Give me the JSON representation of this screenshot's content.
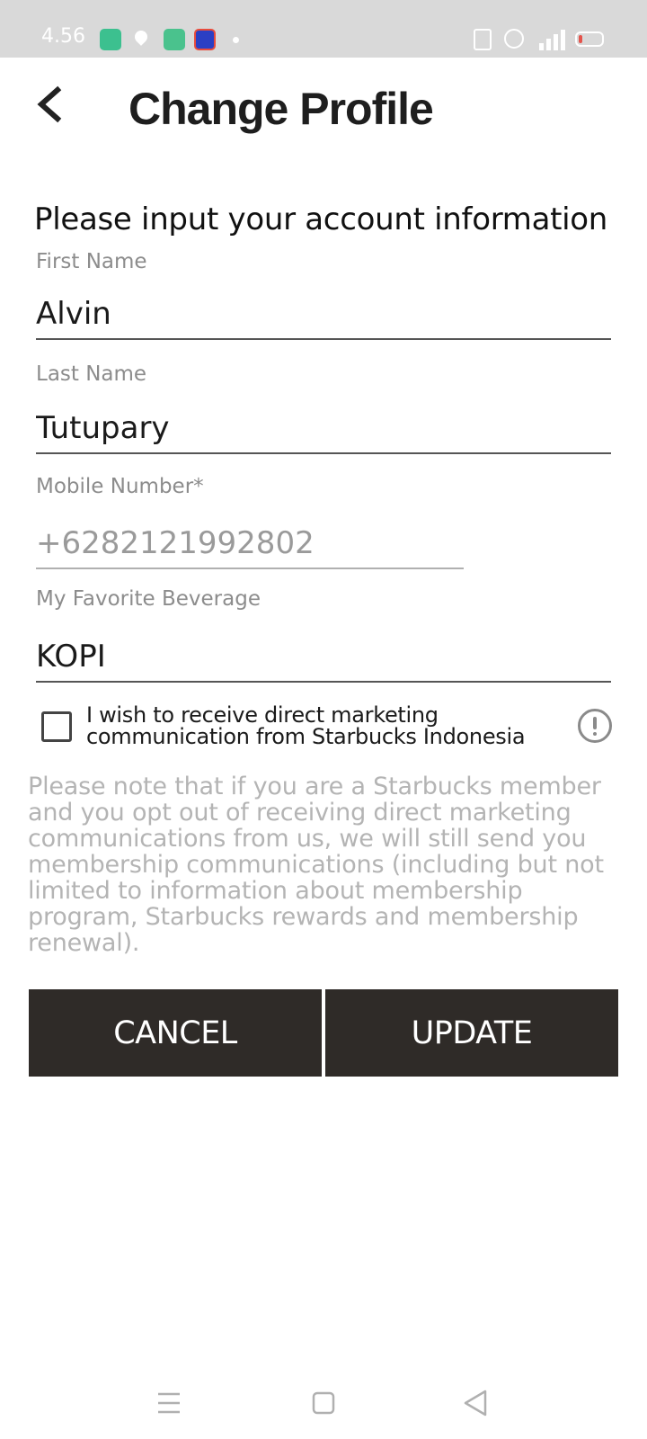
{
  "status_bar": {
    "time": "4.56",
    "icons": [
      "app-icon",
      "location-icon",
      "app-icon",
      "app-icon",
      "notification-dot",
      "vibrate-icon",
      "alarm-icon",
      "signal-4g-icon",
      "battery-icon"
    ]
  },
  "header": {
    "back_icon": "chevron-left-icon",
    "title": "Change Profile"
  },
  "form": {
    "heading": "Please input your account information",
    "first_name": {
      "label": "First Name",
      "value": "Alvin"
    },
    "last_name": {
      "label": "Last Name",
      "value": "Tutupary"
    },
    "mobile": {
      "label": "Mobile Number*",
      "value": "+628212199280​2"
    },
    "beverage": {
      "label": "My Favorite Beverage",
      "value": "KOPI"
    }
  },
  "marketing": {
    "checked": false,
    "label": "I wish to receive direct marketing communication from Starbucks Indonesia",
    "info_icon": "info-icon",
    "disclaimer": "Please note that if you are a Starbucks member and you opt out of receiving direct marketing communications from us, we will still send you membership communications (including but not limited to information about membership program, Starbucks rewards and membership renewal)."
  },
  "actions": {
    "cancel_label": "CANCEL",
    "update_label": "UPDATE"
  },
  "colors": {
    "button_bg": "#2f2b28",
    "status_bar_bg": "#d9d9d9",
    "label_gray": "#8c8c8c",
    "disclaimer_gray": "#b4b4b4"
  },
  "nav_bar": {
    "icons": [
      "menu-icon",
      "home-square-icon",
      "back-triangle-icon"
    ]
  }
}
